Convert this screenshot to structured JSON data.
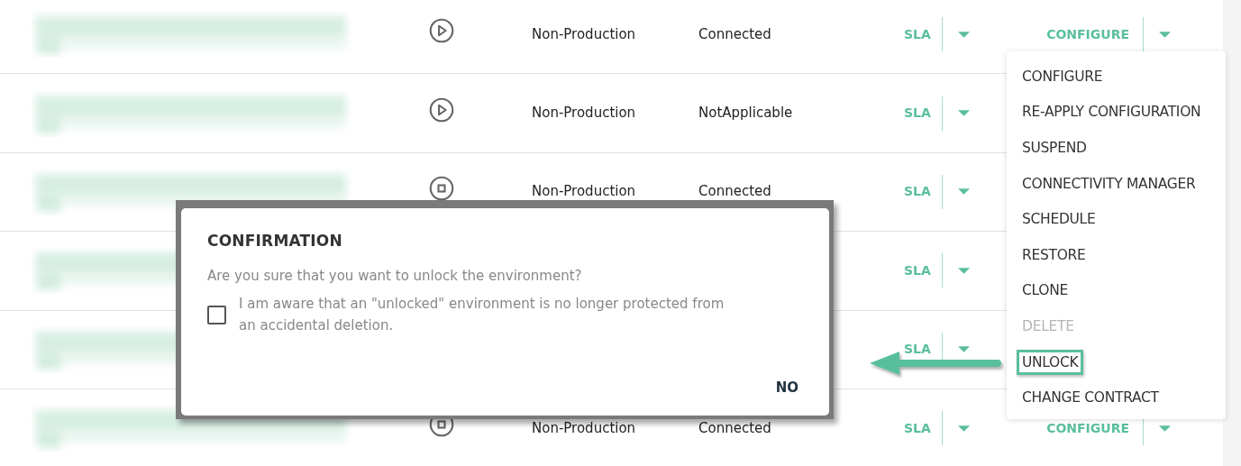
{
  "rows": [
    {
      "kind": "play",
      "type": "Non-Production",
      "status": "Connected",
      "sla": "SLA",
      "configure": "CONFIGURE"
    },
    {
      "kind": "play",
      "type": "Non-Production",
      "status": "NotApplicable",
      "sla": "SLA"
    },
    {
      "kind": "stop",
      "type": "Non-Production",
      "status": "Connected",
      "sla": "SLA"
    },
    {
      "sla": "SLA"
    },
    {
      "sla": "SLA"
    },
    {
      "kind": "stop",
      "type": "Non-Production",
      "status": "Connected",
      "sla": "SLA",
      "configure": "CONFIGURE"
    }
  ],
  "menu": {
    "items": [
      {
        "label": "CONFIGURE",
        "disabled": false,
        "highlighted": false
      },
      {
        "label": "RE-APPLY CONFIGURATION",
        "disabled": false,
        "highlighted": false
      },
      {
        "label": "SUSPEND",
        "disabled": false,
        "highlighted": false
      },
      {
        "label": "CONNECTIVITY MANAGER",
        "disabled": false,
        "highlighted": false
      },
      {
        "label": "SCHEDULE",
        "disabled": false,
        "highlighted": false
      },
      {
        "label": "RESTORE",
        "disabled": false,
        "highlighted": false
      },
      {
        "label": "CLONE",
        "disabled": false,
        "highlighted": false
      },
      {
        "label": "DELETE",
        "disabled": true,
        "highlighted": false
      },
      {
        "label": "UNLOCK",
        "disabled": false,
        "highlighted": true
      },
      {
        "label": "CHANGE CONTRACT",
        "disabled": false,
        "highlighted": false
      }
    ]
  },
  "dialog": {
    "title": "CONFIRMATION",
    "message": "Are you sure that you want to unlock the environment?",
    "checkbox": {
      "label": "I am aware that an \"unlocked\" environment is no longer protected from an accidental deletion.",
      "checked": false
    },
    "buttons": [
      "NO"
    ]
  }
}
